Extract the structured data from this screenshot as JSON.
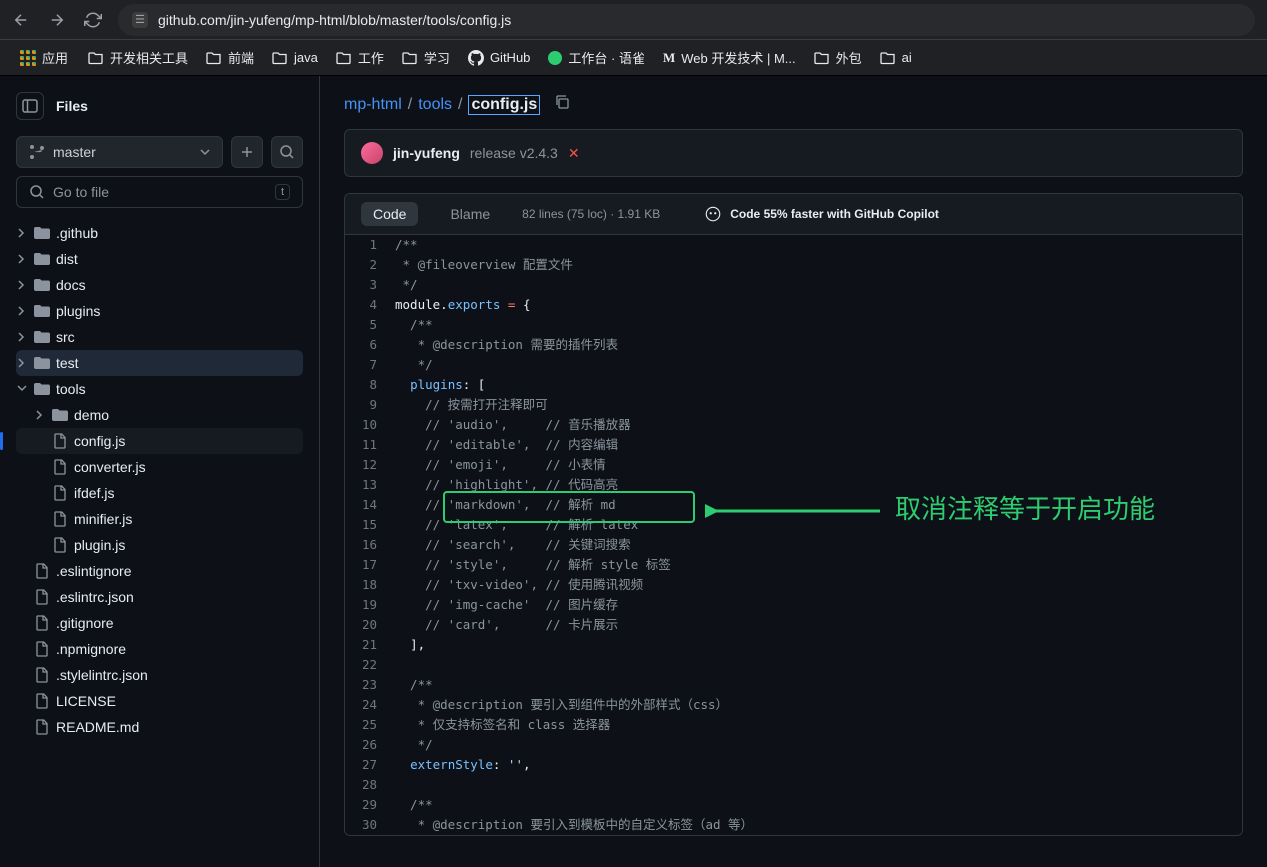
{
  "url": "github.com/jin-yufeng/mp-html/blob/master/tools/config.js",
  "bookmarks": {
    "apps": "应用",
    "items": [
      "开发相关工具",
      "前端",
      "java",
      "工作",
      "学习",
      "GitHub",
      "工作台 · 语雀",
      "Web 开发技术 | M...",
      "外包",
      "ai"
    ]
  },
  "sidebar": {
    "title": "Files",
    "branch": "master",
    "go_to_file": "Go to file",
    "kbd": "t",
    "tree": [
      {
        "t": "folder",
        "n": ".github",
        "d": 0,
        "open": false
      },
      {
        "t": "folder",
        "n": "dist",
        "d": 0,
        "open": false
      },
      {
        "t": "folder",
        "n": "docs",
        "d": 0,
        "open": false
      },
      {
        "t": "folder",
        "n": "plugins",
        "d": 0,
        "open": false
      },
      {
        "t": "folder",
        "n": "src",
        "d": 0,
        "open": false
      },
      {
        "t": "folder",
        "n": "test",
        "d": 0,
        "open": false,
        "sel": true
      },
      {
        "t": "folder",
        "n": "tools",
        "d": 0,
        "open": true
      },
      {
        "t": "folder",
        "n": "demo",
        "d": 1,
        "open": false
      },
      {
        "t": "file",
        "n": "config.js",
        "d": 1,
        "active": true
      },
      {
        "t": "file",
        "n": "converter.js",
        "d": 1
      },
      {
        "t": "file",
        "n": "ifdef.js",
        "d": 1
      },
      {
        "t": "file",
        "n": "minifier.js",
        "d": 1
      },
      {
        "t": "file",
        "n": "plugin.js",
        "d": 1
      },
      {
        "t": "file",
        "n": ".eslintignore",
        "d": 0
      },
      {
        "t": "file",
        "n": ".eslintrc.json",
        "d": 0
      },
      {
        "t": "file",
        "n": ".gitignore",
        "d": 0
      },
      {
        "t": "file",
        "n": ".npmignore",
        "d": 0
      },
      {
        "t": "file",
        "n": ".stylelintrc.json",
        "d": 0
      },
      {
        "t": "file",
        "n": "LICENSE",
        "d": 0
      },
      {
        "t": "file",
        "n": "README.md",
        "d": 0
      }
    ]
  },
  "breadcrumb": {
    "repo": "mp-html",
    "parts": [
      "tools"
    ],
    "file": "config.js"
  },
  "commit": {
    "author": "jin-yufeng",
    "msg": "release v2.4.3"
  },
  "codeHeader": {
    "code": "Code",
    "blame": "Blame",
    "meta": "82 lines (75 loc) · 1.91 KB",
    "copilot": "Code 55% faster with GitHub Copilot"
  },
  "code": [
    {
      "n": 1,
      "h": "/**"
    },
    {
      "n": 2,
      "h": " * @fileoverview 配置文件"
    },
    {
      "n": 3,
      "h": " */"
    },
    {
      "n": 4,
      "h": "<span class='w'>module.</span><span class='p'>exports</span><span class='w'> </span><span class='k'>=</span><span class='w'> {</span>"
    },
    {
      "n": 5,
      "h": "  /**"
    },
    {
      "n": 6,
      "h": "   * @description 需要的插件列表"
    },
    {
      "n": 7,
      "h": "   */"
    },
    {
      "n": 8,
      "h": "  <span class='p'>plugins</span><span class='w'>: [</span>"
    },
    {
      "n": 9,
      "h": "    // 按需打开注释即可"
    },
    {
      "n": 10,
      "h": "    // 'audio',     // 音乐播放器"
    },
    {
      "n": 11,
      "h": "    // 'editable',  // 内容编辑"
    },
    {
      "n": 12,
      "h": "    // 'emoji',     // 小表情"
    },
    {
      "n": 13,
      "h": "    // 'highlight', // 代码高亮"
    },
    {
      "n": 14,
      "h": "    // 'markdown',  // 解析 md"
    },
    {
      "n": 15,
      "h": "    // 'latex',     // 解析 latex"
    },
    {
      "n": 16,
      "h": "    // 'search',    // 关键词搜索"
    },
    {
      "n": 17,
      "h": "    // 'style',     // 解析 style 标签"
    },
    {
      "n": 18,
      "h": "    // 'txv-video', // 使用腾讯视频"
    },
    {
      "n": 19,
      "h": "    // 'img-cache'  // 图片缓存"
    },
    {
      "n": 20,
      "h": "    // 'card',      // 卡片展示"
    },
    {
      "n": 21,
      "h": "  <span class='w'>],</span>"
    },
    {
      "n": 22,
      "h": ""
    },
    {
      "n": 23,
      "h": "  /**"
    },
    {
      "n": 24,
      "h": "   * @description 要引入到组件中的外部样式（css）"
    },
    {
      "n": 25,
      "h": "   * 仅支持标签名和 class 选择器"
    },
    {
      "n": 26,
      "h": "   */"
    },
    {
      "n": 27,
      "h": "  <span class='p'>externStyle</span><span class='w'>: </span><span class='s'>''</span><span class='w'>,</span>"
    },
    {
      "n": 28,
      "h": ""
    },
    {
      "n": 29,
      "h": "  /**"
    },
    {
      "n": 30,
      "h": "   * @description 要引入到模板中的自定义标签（ad 等）"
    }
  ],
  "annotation": "取消注释等于开启功能",
  "highlightLine": 15
}
